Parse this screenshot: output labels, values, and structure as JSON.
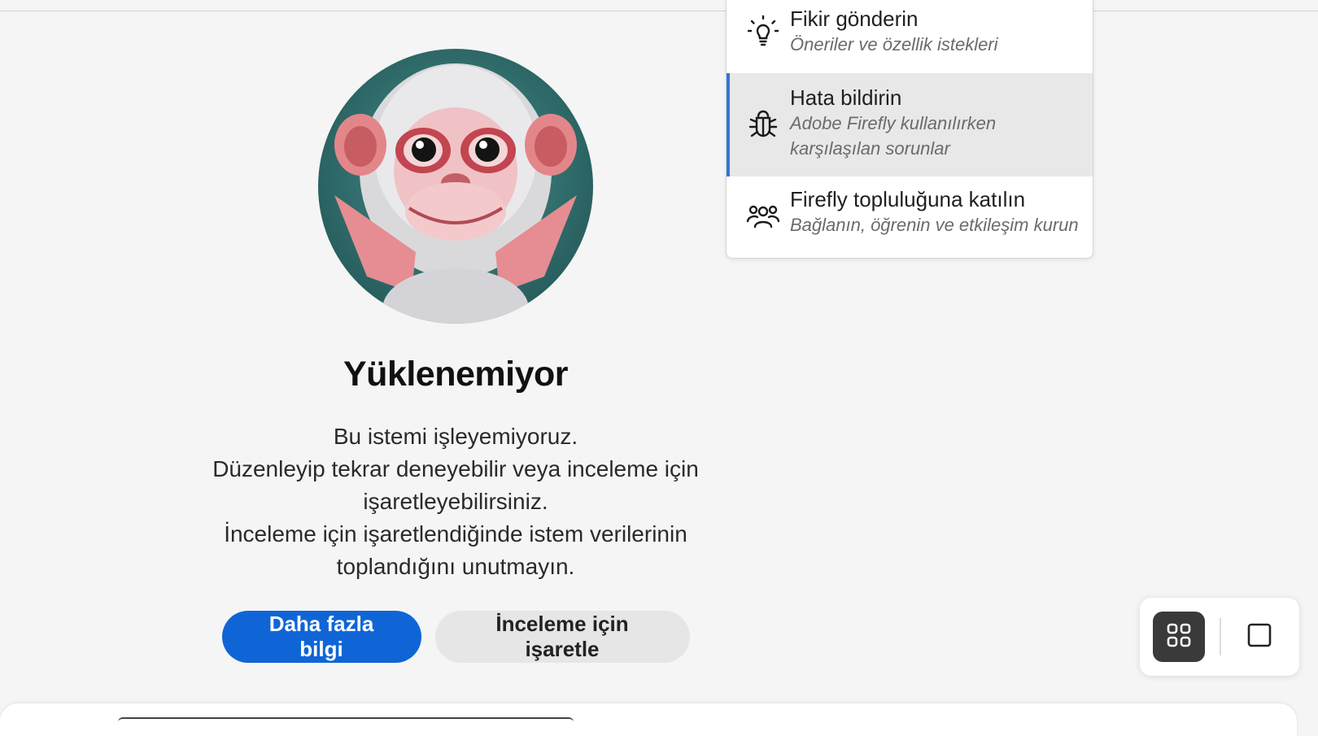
{
  "error": {
    "title": "Yüklenemiyor",
    "lines": [
      "Bu istemi işleyemiyoruz.",
      "Düzenleyip tekrar deneyebilir veya inceleme için",
      "işaretleyebilirsiniz.",
      "İnceleme için işaretlendiğinde istem verilerinin",
      "toplandığını unutmayın."
    ],
    "learn_more_label": "Daha fazla bilgi",
    "flag_label": "İnceleme için işaretle"
  },
  "menu": {
    "items": [
      {
        "icon": "lightbulb-icon",
        "title": "Fikir gönderin",
        "subtitle_lines": [
          "Öneriler ve özellik istekleri"
        ]
      },
      {
        "icon": "bug-icon",
        "title": "Hata bildirin",
        "subtitle_lines": [
          "Adobe Firefly kullanılırken",
          "karşılaşılan sorunlar"
        ],
        "highlighted": true
      },
      {
        "icon": "community-icon",
        "title": "Firefly topluluğuna katılın",
        "subtitle_lines": [
          "Bağlanın, öğrenin ve etkileşim kurun"
        ]
      }
    ]
  },
  "view_switcher": {
    "options": [
      "grid-view-icon",
      "single-view-icon"
    ],
    "selected": "grid-view-icon"
  },
  "colors": {
    "primary": "#1065d6",
    "highlight_border": "#2e76d8",
    "background": "#f5f5f5"
  }
}
